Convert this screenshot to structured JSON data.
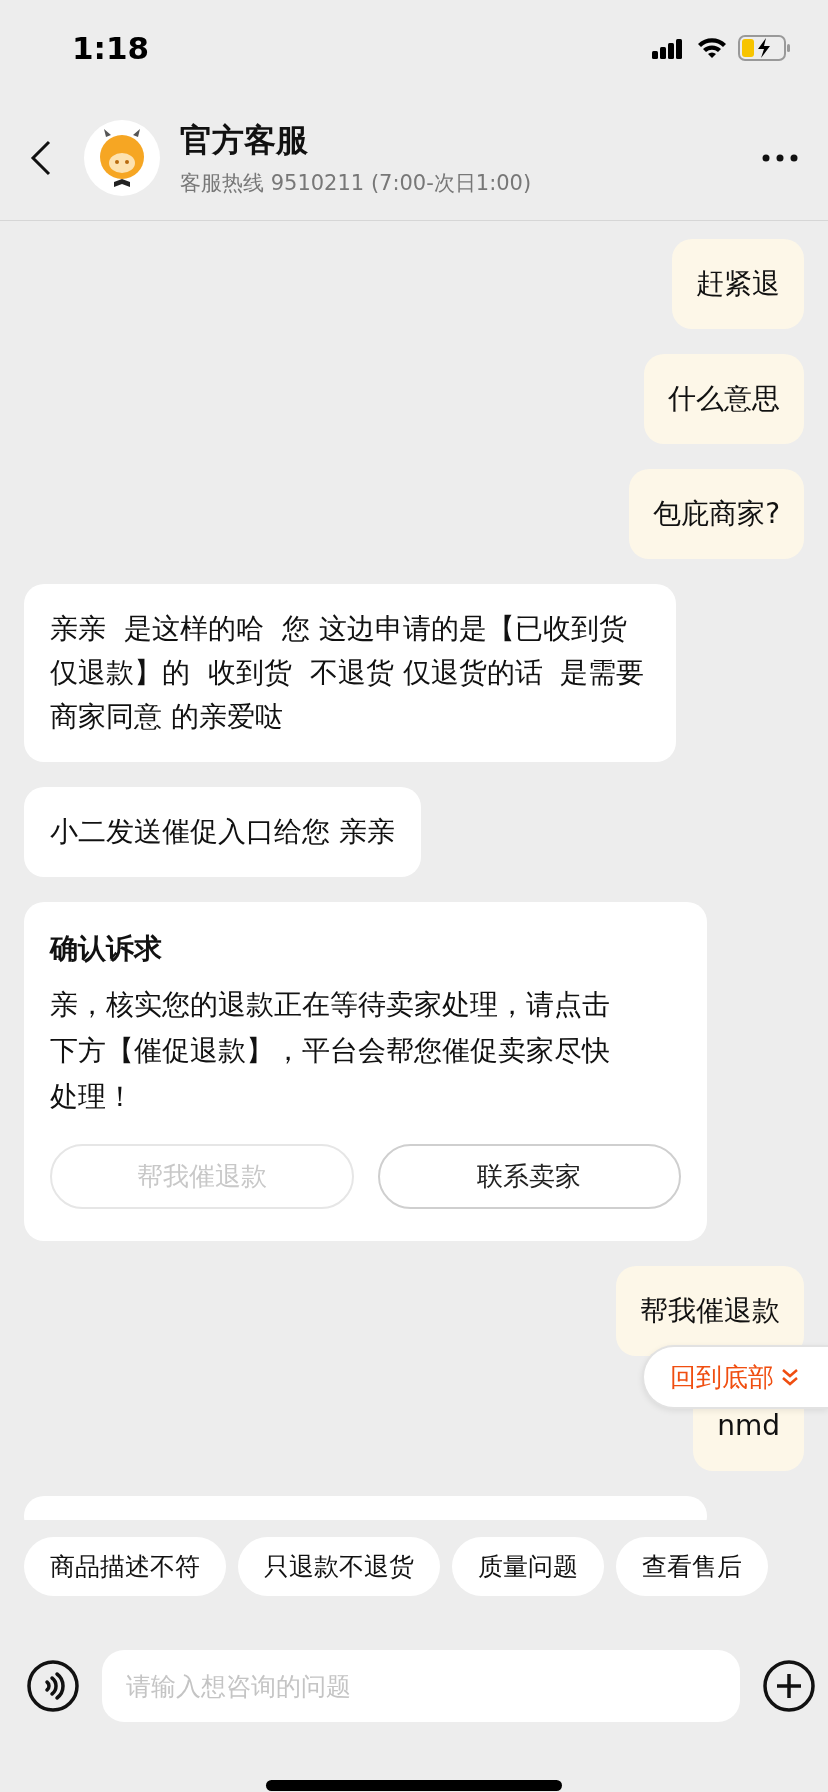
{
  "status_bar": {
    "time": "1:18"
  },
  "header": {
    "title": "官方客服",
    "subtitle": "客服热线 9510211 (7:00-次日1:00)"
  },
  "messages": [
    {
      "kind": "text",
      "outgoing": true,
      "text": "赶紧退"
    },
    {
      "kind": "text",
      "outgoing": true,
      "text": "什么意思"
    },
    {
      "kind": "text",
      "outgoing": true,
      "text": "包庇商家?"
    },
    {
      "kind": "text",
      "outgoing": false,
      "text": "亲亲  是这样的哈  您 这边申请的是【已收到货仅退款】的  收到货  不退货 仅退货的话  是需要商家同意 的亲爱哒"
    },
    {
      "kind": "text",
      "outgoing": false,
      "text": "小二发送催促入口给您 亲亲"
    },
    {
      "kind": "card",
      "outgoing": false,
      "title": "确认诉求",
      "text": "亲，核实您的退款正在等待卖家处理，请点击下方【催促退款】，平台会帮您催促卖家尽快处理！",
      "buttons": [
        {
          "label": "帮我催退款",
          "disabled": true
        },
        {
          "label": "联系卖家",
          "disabled": false
        }
      ]
    },
    {
      "kind": "text",
      "outgoing": true,
      "text": "帮我催退款"
    },
    {
      "kind": "text",
      "outgoing": true,
      "text": "nmd"
    },
    {
      "kind": "partial",
      "outgoing": false
    }
  ],
  "scroll_button": {
    "label": "回到底部"
  },
  "quick_replies": [
    "商品描述不符",
    "只退款不退货",
    "质量问题",
    "查看售后"
  ],
  "input": {
    "placeholder": "请输入想咨询的问题"
  }
}
